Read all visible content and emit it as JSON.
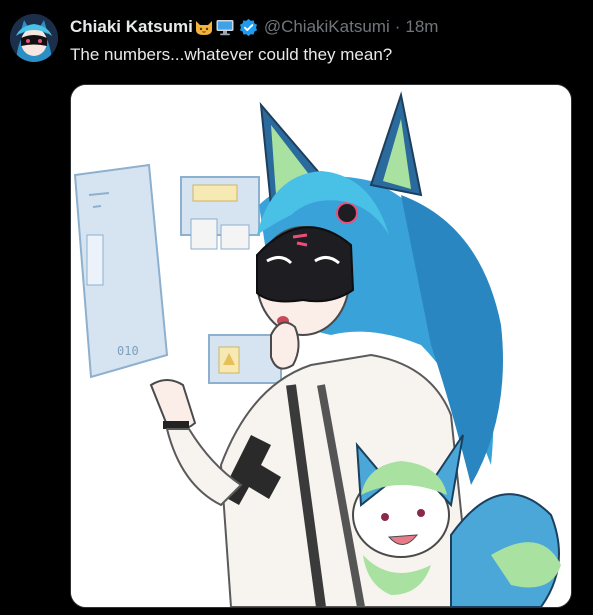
{
  "tweet": {
    "author": {
      "display_name": "Chiaki Katsumi",
      "name_emojis": [
        "cat-face-icon",
        "computer-monitor-icon"
      ],
      "verified": true,
      "handle": "@ChiakiKatsumi",
      "separator": "·",
      "timestamp": "18m"
    },
    "text": "The numbers...whatever could they mean?",
    "media": {
      "type": "image",
      "alt": "",
      "screen_text": "010"
    }
  },
  "colors": {
    "background": "#000000",
    "primary_text": "#e7e9ea",
    "secondary_text": "#71767b",
    "verified_badge": "#1d9bf0",
    "media_border": "#2f3336"
  }
}
